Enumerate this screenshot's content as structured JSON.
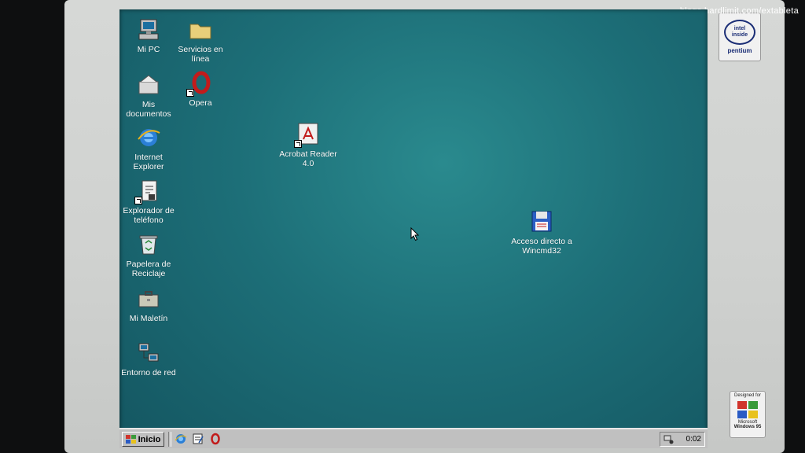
{
  "watermark": "blogs.hardlimit.com/extableta",
  "stickers": {
    "intel_line1": "intel",
    "intel_line2": "inside",
    "intel_brand": "pentium",
    "win_designed": "Designed for",
    "win_brand": "Microsoft",
    "win_product": "Windows 95"
  },
  "desktop": {
    "icons": [
      {
        "id": "mi-pc",
        "label": "Mi PC",
        "icon": "computer-icon"
      },
      {
        "id": "servicios",
        "label": "Servicios en línea",
        "icon": "folder-icon"
      },
      {
        "id": "mis-documentos",
        "label": "Mis documentos",
        "icon": "documents-folder-icon"
      },
      {
        "id": "opera",
        "label": "Opera",
        "icon": "opera-icon"
      },
      {
        "id": "ie",
        "label": "Internet Explorer",
        "icon": "internet-explorer-icon"
      },
      {
        "id": "acrobat",
        "label": "Acrobat Reader 4.0",
        "icon": "acrobat-icon"
      },
      {
        "id": "explorador-telefono",
        "label": "Explorador de teléfono",
        "icon": "phone-explorer-icon"
      },
      {
        "id": "papelera",
        "label": "Papelera de Reciclaje",
        "icon": "recycle-bin-icon"
      },
      {
        "id": "maletin",
        "label": "Mi Maletín",
        "icon": "briefcase-icon"
      },
      {
        "id": "wincmd",
        "label": "Acceso directo a Wincmd32",
        "icon": "floppy-disk-icon"
      },
      {
        "id": "entorno-red",
        "label": "Entorno de red",
        "icon": "network-icon"
      }
    ]
  },
  "taskbar": {
    "start_label": "Inicio",
    "quick_launch": [
      "internet-explorer-icon",
      "notepad-icon",
      "opera-icon"
    ],
    "clock": "0:02"
  },
  "colors": {
    "desktop": "#1d6f78",
    "taskbar": "#c0c0c0"
  }
}
